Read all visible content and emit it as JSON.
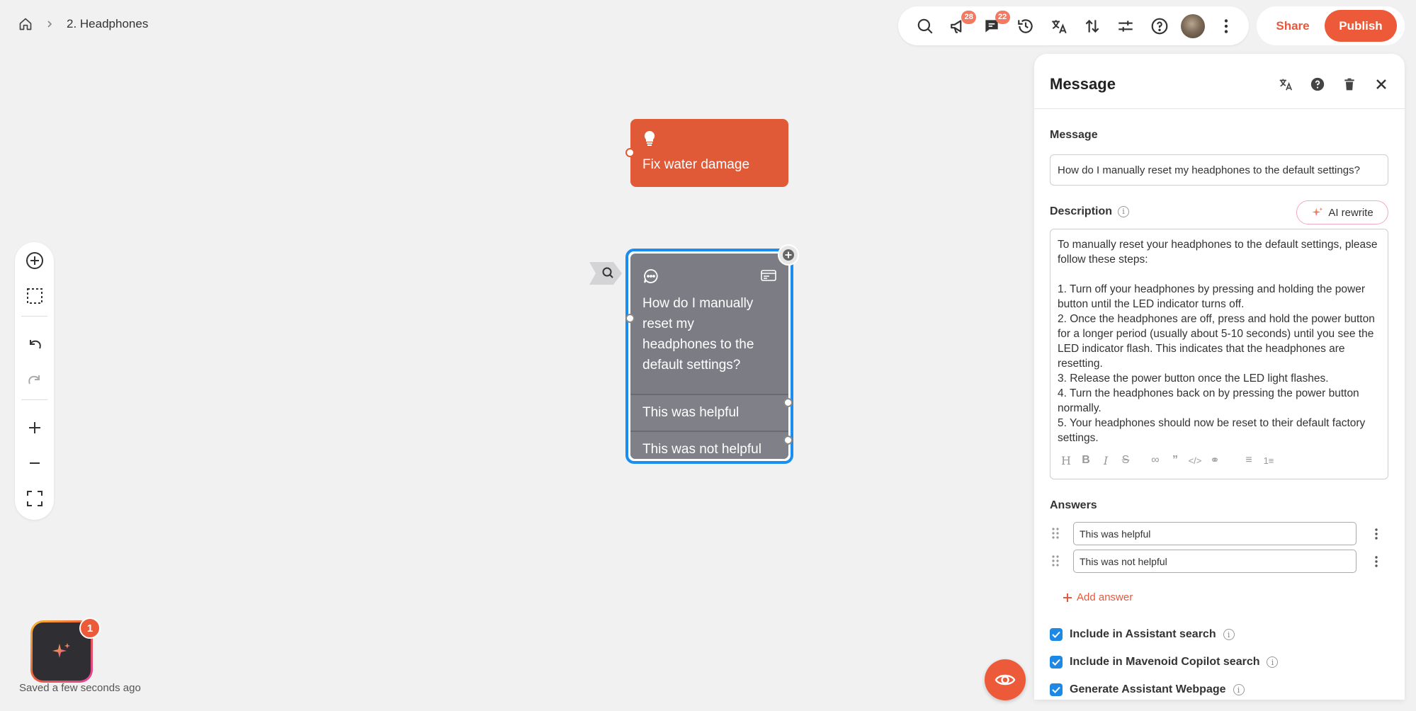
{
  "breadcrumb": {
    "current": "2. Headphones"
  },
  "toolbar": {
    "announcements_count": "28",
    "comments_count": "22",
    "share_label": "Share",
    "publish_label": "Publish"
  },
  "canvas": {
    "tip_node": {
      "text": "Fix water damage"
    },
    "message_node": {
      "question": "How do I manually reset my headphones to the default settings?",
      "answers": [
        "This was helpful",
        "This was not helpful"
      ]
    }
  },
  "ai_assistant": {
    "badge_count": "1"
  },
  "status": {
    "saved": "Saved a few seconds ago"
  },
  "panel": {
    "title": "Message",
    "message_label": "Message",
    "message_value": "How do I manually reset my headphones to the default settings?",
    "description_label": "Description",
    "ai_rewrite_label": "AI rewrite",
    "description_text": "To manually reset your headphones to the default settings, please follow these steps:\n\n1. Turn off your headphones by pressing and holding the power button until the LED indicator turns off.\n2. Once the headphones are off, press and hold the power button for a longer period (usually about 5-10 seconds) until you see the LED indicator flash. This indicates that the headphones are resetting.\n3. Release the power button once the LED light flashes.\n4. Turn the headphones back on by pressing the power button normally.\n5. Your headphones should now be reset to their default factory settings.",
    "answers_label": "Answers",
    "answers": [
      "This was helpful",
      "This was not helpful"
    ],
    "add_answer_label": "Add answer",
    "options": [
      {
        "label": "Include in Assistant search",
        "checked": true
      },
      {
        "label": "Include in Mavenoid Copilot search",
        "checked": true
      },
      {
        "label": "Generate Assistant Webpage",
        "checked": true
      }
    ]
  },
  "colors": {
    "accent": "#ec5a3a",
    "selection": "#1a8df0",
    "node_gray": "#7b7c84",
    "tip_node": "#e05a38"
  }
}
